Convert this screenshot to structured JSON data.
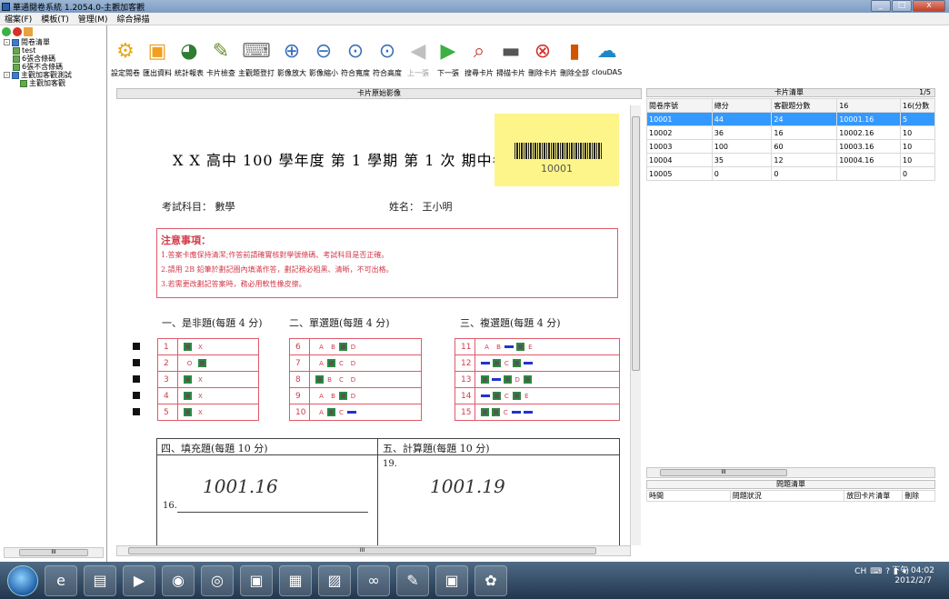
{
  "window": {
    "title": "華通閱卷系統 1.2054.0-主觀加客觀",
    "buttons": [
      "_",
      "□",
      "x"
    ]
  },
  "menu": [
    "檔案(F)",
    "模板(T)",
    "管理(M)",
    "綜合掃描"
  ],
  "tree": {
    "items": [
      {
        "label": "閱卷清單",
        "level": 0
      },
      {
        "label": "test",
        "level": 1
      },
      {
        "label": "6張含條碼",
        "level": 1
      },
      {
        "label": "6張不含條碼",
        "level": 1
      },
      {
        "label": "主觀加客觀測試",
        "level": 1
      },
      {
        "label": "主觀加客觀",
        "level": 2
      }
    ]
  },
  "toolbar": [
    {
      "label": "設定閱卷",
      "icon": "gear-icon"
    },
    {
      "label": "匯出資料",
      "icon": "export-icon"
    },
    {
      "label": "統計報表",
      "icon": "pie-chart-icon"
    },
    {
      "label": "卡片檢查",
      "icon": "check-icon"
    },
    {
      "label": "主觀題登打",
      "icon": "keyboard-icon"
    },
    {
      "label": "影像放大",
      "icon": "zoom-in-icon"
    },
    {
      "label": "影像縮小",
      "icon": "zoom-out-icon"
    },
    {
      "label": "符合寬度",
      "icon": "fit-width-icon"
    },
    {
      "label": "符合高度",
      "icon": "fit-height-icon"
    },
    {
      "label": "上一張",
      "icon": "arrow-left-icon",
      "disabled": true
    },
    {
      "label": "下一張",
      "icon": "arrow-right-icon"
    },
    {
      "label": "搜尋卡片",
      "icon": "search-card-icon"
    },
    {
      "label": "掃描卡片",
      "icon": "scanner-icon"
    },
    {
      "label": "刪除卡片",
      "icon": "delete-card-icon"
    },
    {
      "label": "刪除全部",
      "icon": "trash-icon"
    },
    {
      "label": "clouDAS",
      "icon": "cloud-icon"
    }
  ],
  "card": {
    "header": "卡片原始影像",
    "exam_title": "X X 高中 100 學年度 第 1 學期 第 1 次 期中考",
    "barcode": "10001",
    "subject": "考試科目： 數學",
    "name": "姓名： 王小明",
    "notes_title": "注意事項：",
    "notes": [
      "1.答案卡應保持清潔;作答前請確實核對學號條碼、考試科目是否正確。",
      "2.請用 2B 鉛筆於劃記圈內填滿作答，劃記務必粗黑、清晰，不可出格。",
      "3.若需更改劃記答案時，務必用軟性橡皮擦。"
    ],
    "sec1": "一、是非題(每題 4 分)",
    "sec2": "二、單選題(每題 4 分)",
    "sec3": "三、複選題(每題 4 分)",
    "tf_rows": [
      "1",
      "2",
      "3",
      "4",
      "5"
    ],
    "sc_rows": [
      "6",
      "7",
      "8",
      "9",
      "10"
    ],
    "mc_rows": [
      "11",
      "12",
      "13",
      "14",
      "15"
    ],
    "tf_opts": [
      "O",
      "X"
    ],
    "sc_opts": [
      "A",
      "B",
      "C",
      "D"
    ],
    "mc_opts": [
      "A",
      "B",
      "C",
      "D",
      "E"
    ],
    "sec4": "四、填充題(每題 10 分)",
    "sec5": "五、計算題(每題 10 分)",
    "q16": "16.",
    "q19": "19.",
    "ans16": "1001.16",
    "ans19": "1001.19"
  },
  "cardlist": {
    "title": "卡片清單",
    "page": "1/5",
    "columns": [
      "閱卷序號",
      "總分",
      "客觀題分數",
      "16",
      "16(分數"
    ],
    "rows": [
      [
        "10001",
        "44",
        "24",
        "10001.16",
        "5"
      ],
      [
        "10002",
        "36",
        "16",
        "10002.16",
        "10"
      ],
      [
        "10003",
        "100",
        "60",
        "10003.16",
        "10"
      ],
      [
        "10004",
        "35",
        "12",
        "10004.16",
        "10"
      ],
      [
        "10005",
        "0",
        "0",
        "",
        "0"
      ]
    ]
  },
  "issues": {
    "title": "問題清單",
    "columns": [
      "時間",
      "問題狀況",
      "放回卡片清單",
      "刪除"
    ]
  },
  "taskbar": {
    "tray_lang": "CH",
    "time": "下午 04:02",
    "date": "2012/2/7"
  },
  "colors": {
    "selection": "#3399ff",
    "barcode_bg": "#fdf58a",
    "answer_red": "#d23a4a"
  }
}
